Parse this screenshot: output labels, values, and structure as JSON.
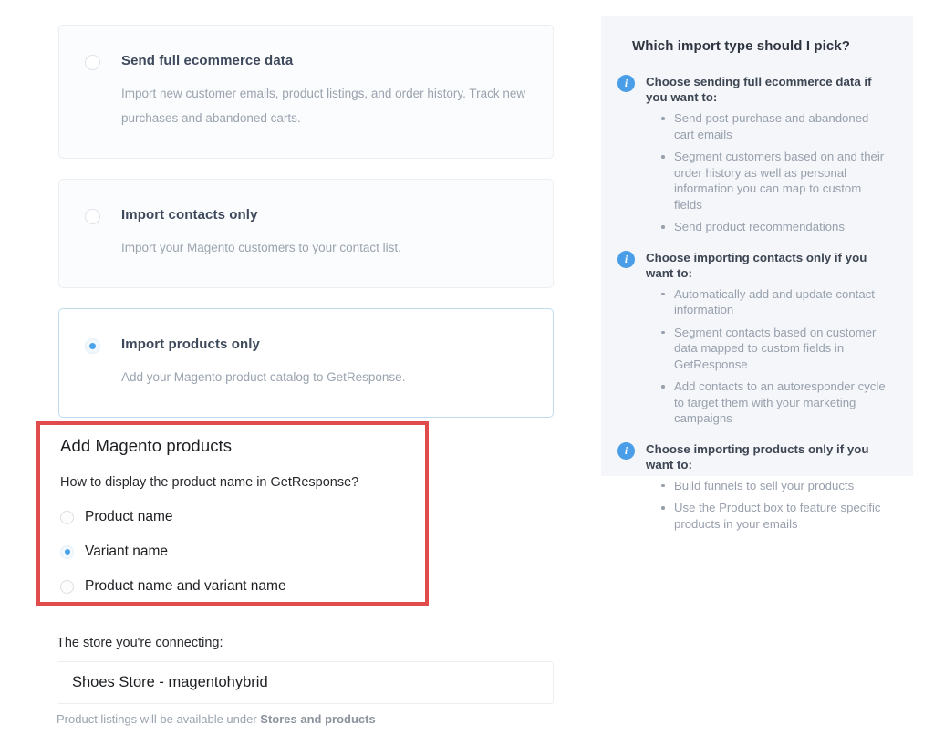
{
  "import_options": [
    {
      "title": "Send full ecommerce data",
      "description": "Import new customer emails, product listings, and order history. Track new purchases and abandoned carts.",
      "selected": false
    },
    {
      "title": "Import contacts only",
      "description": "Import your Magento customers to your contact list.",
      "selected": false
    },
    {
      "title": "Import products only",
      "description": "Add your Magento product catalog to GetResponse.",
      "selected": true
    }
  ],
  "product_section": {
    "title": "Add Magento products",
    "question": "How to display the product name in GetResponse?",
    "highlight_color": "#e04c4c",
    "options": [
      {
        "label": "Product name",
        "selected": false
      },
      {
        "label": "Variant name",
        "selected": true
      },
      {
        "label": "Product name and variant name",
        "selected": false
      }
    ]
  },
  "store": {
    "label": "The store you're connecting:",
    "value": "Shoes Store - magentohybrid",
    "hint_prefix": "Product listings will be available under ",
    "hint_strong": "Stores and products"
  },
  "help_panel": {
    "title": "Which import type should I pick?",
    "accent_color": "#4a9ee8",
    "background_color": "#f4f6f9",
    "groups": [
      {
        "icon": "info-icon",
        "heading": "Choose sending full ecommerce data if you want to:",
        "items": [
          "Send post-purchase and abandoned cart emails",
          "Segment customers based on and their order history as well as personal information you can map to custom fields",
          "Send product recommendations"
        ]
      },
      {
        "icon": "info-icon",
        "heading": "Choose importing contacts only if you want to:",
        "items": [
          "Automatically add and update contact information",
          "Segment contacts based on customer data mapped to custom fields in GetResponse",
          "Add contacts to an autoresponder cycle to target them with your marketing campaigns"
        ]
      },
      {
        "icon": "info-icon",
        "heading": "Choose importing products only if you want to:",
        "items": [
          "Build funnels to sell your products",
          "Use the Product box to feature specific products in your emails"
        ]
      }
    ]
  }
}
